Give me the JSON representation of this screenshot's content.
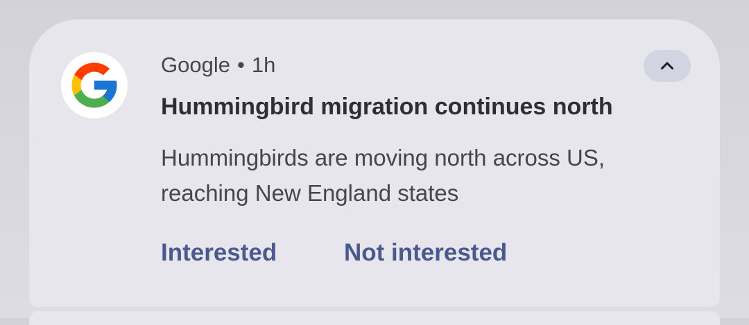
{
  "notification": {
    "app_name": "Google",
    "separator": "•",
    "time": "1h",
    "app_icon": "google-g-icon",
    "collapse_icon": "chevron-up-icon",
    "title": "Hummingbird migration continues north",
    "body_lines": [
      "Hummingbirds are moving north across US,",
      "reaching New England states"
    ],
    "actions": [
      {
        "label": "Interested"
      },
      {
        "label": "Not interested"
      }
    ]
  },
  "colors": {
    "card_background": "#e6e6ec",
    "action_text": "#4a5a8e",
    "collapse_button_background": "#d2d4e2",
    "google_blue": "#4285F4",
    "google_red": "#EA4335",
    "google_yellow": "#FBBC05",
    "google_green": "#34A853"
  }
}
